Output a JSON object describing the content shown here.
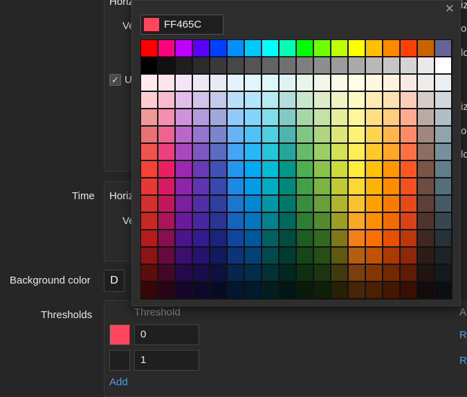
{
  "background_form": {
    "top_label_a": "Horiz",
    "top_label_b": "Ve",
    "check_label": "U",
    "right_labels": [
      "iz",
      "ol",
      "lo",
      "iz",
      "ol",
      "lo"
    ],
    "time_label": "Time",
    "time_horiz": "Horiz",
    "time_ve": "Ve",
    "background_color_label": "Background color",
    "background_color_value": "D",
    "thresholds_label": "Thresholds",
    "threshold_col_header": "Threshold",
    "threshold_col_right": "A",
    "thresholds": [
      {
        "color": "#FF465C",
        "value": "0",
        "action": "R"
      },
      {
        "color": "#1f1f1f",
        "value": "1",
        "action": "R"
      }
    ],
    "add_link": "Add"
  },
  "color_picker": {
    "hex_value": "FF465C",
    "hex_color": "#FF465C",
    "close_icon": "close-icon",
    "palette": [
      [
        "#FF0000",
        "#FF0080",
        "#C000FF",
        "#5A00FF",
        "#0040FF",
        "#0090FF",
        "#00C8FF",
        "#00FFFF",
        "#00FFB4",
        "#00FF00",
        "#70FF00",
        "#C0FF00",
        "#FFFF00",
        "#FFC000",
        "#FF8A00",
        "#FF4000",
        "#C86400",
        "#646496"
      ],
      [
        "#000000",
        "#111111",
        "#1E1E1E",
        "#2B2B2B",
        "#393939",
        "#474747",
        "#555555",
        "#636363",
        "#717171",
        "#7F7F7F",
        "#8E8E8E",
        "#9C9C9C",
        "#AAAAAA",
        "#B8B8B8",
        "#C6C6C6",
        "#D4D4D4",
        "#E9E9E9",
        "#FFFFFF"
      ],
      [
        "#FFEBEE",
        "#FCE4EC",
        "#F3E5F5",
        "#EDE7F6",
        "#E8EAF6",
        "#E3F2FD",
        "#E1F5FE",
        "#E0F7FA",
        "#E0F2F1",
        "#E8F5E9",
        "#F1F8E9",
        "#F9FBE7",
        "#FFFDE7",
        "#FFF8E1",
        "#FFF3E0",
        "#FBE9E7",
        "#EFEBE9",
        "#ECEFF1"
      ],
      [
        "#FFCDD2",
        "#F8BBD0",
        "#E1BEE7",
        "#D1C4E9",
        "#C5CAE9",
        "#BBDEFB",
        "#B3E5FC",
        "#B2EBF2",
        "#B2DFDB",
        "#C8E6C9",
        "#DCEDC8",
        "#F0F4C3",
        "#FFF9C4",
        "#FFECB3",
        "#FFE0B2",
        "#FFCCBC",
        "#D7CCC8",
        "#CFD8DC"
      ],
      [
        "#EF9A9A",
        "#F48FB1",
        "#CE93D8",
        "#B39DDB",
        "#9FA8DA",
        "#90CAF9",
        "#81D4FA",
        "#80DEEA",
        "#80CBC4",
        "#A5D6A7",
        "#C5E1A5",
        "#E6EE9C",
        "#FFF59D",
        "#FFE082",
        "#FFCC80",
        "#FFAB91",
        "#BCAAA4",
        "#B0BEC5"
      ],
      [
        "#E57373",
        "#F06292",
        "#BA68C8",
        "#9575CD",
        "#7986CB",
        "#64B5F6",
        "#4FC3F7",
        "#4DD0E1",
        "#4DB6AC",
        "#81C784",
        "#AED581",
        "#DCE775",
        "#FFF176",
        "#FFD54F",
        "#FFB74D",
        "#FF8A65",
        "#A1887F",
        "#90A4AE"
      ],
      [
        "#EF5350",
        "#EC407A",
        "#AB47BC",
        "#7E57C2",
        "#5C6BC0",
        "#42A5F5",
        "#29B6F6",
        "#26C6DA",
        "#26A69A",
        "#66BB6A",
        "#9CCC65",
        "#D4E157",
        "#FFEE58",
        "#FFCA28",
        "#FFA726",
        "#FF7043",
        "#8D6E63",
        "#78909C"
      ],
      [
        "#F44336",
        "#E91E63",
        "#9C27B0",
        "#673AB7",
        "#3F51B5",
        "#2196F3",
        "#03A9F4",
        "#00BCD4",
        "#009688",
        "#4CAF50",
        "#8BC34A",
        "#CDDC39",
        "#FFEB3B",
        "#FFC107",
        "#FF9800",
        "#FF5722",
        "#795548",
        "#607D8B"
      ],
      [
        "#E53935",
        "#D81B60",
        "#8E24AA",
        "#5E35B1",
        "#3949AB",
        "#1E88E5",
        "#039BE5",
        "#00ACC1",
        "#00897B",
        "#43A047",
        "#7CB342",
        "#C0CA33",
        "#FDD835",
        "#FFB300",
        "#FB8C00",
        "#F4511E",
        "#6D4C41",
        "#546E7A"
      ],
      [
        "#D32F2F",
        "#C2185B",
        "#7B1FA2",
        "#512DA8",
        "#303F9F",
        "#1976D2",
        "#0288D1",
        "#0097A7",
        "#00796B",
        "#388E3C",
        "#689F38",
        "#AFB42B",
        "#FBC02D",
        "#FFA000",
        "#F57C00",
        "#E64A19",
        "#5D4037",
        "#455A64"
      ],
      [
        "#C62828",
        "#AD1457",
        "#6A1B9A",
        "#4527A0",
        "#283593",
        "#1565C0",
        "#0277BD",
        "#00838F",
        "#00695C",
        "#2E7D32",
        "#558B2F",
        "#9E9D24",
        "#F9A825",
        "#FF8F00",
        "#EF6C00",
        "#D84315",
        "#4E342E",
        "#37474F"
      ],
      [
        "#B71C1C",
        "#880E4F",
        "#4A148C",
        "#311B92",
        "#1A237E",
        "#0D47A1",
        "#01579B",
        "#006064",
        "#004D40",
        "#1B5E20",
        "#33691E",
        "#827717",
        "#F57F17",
        "#FF6F00",
        "#E65100",
        "#BF360C",
        "#3E2723",
        "#263238"
      ],
      [
        "#8B1414",
        "#650A3A",
        "#3A0F6E",
        "#241470",
        "#121A5E",
        "#0A3678",
        "#014272",
        "#004A4E",
        "#003A30",
        "#144616",
        "#264E16",
        "#5F5810",
        "#B45E10",
        "#C05200",
        "#A83C00",
        "#8E2808",
        "#2C1C18",
        "#1C2428"
      ],
      [
        "#5E0D0D",
        "#450728",
        "#26094A",
        "#180D4C",
        "#0C113F",
        "#072551",
        "#012D4D",
        "#003235",
        "#002821",
        "#0E300F",
        "#1A350F",
        "#41390B",
        "#7A400B",
        "#823700",
        "#722800",
        "#601B05",
        "#1F1410",
        "#13191C"
      ],
      [
        "#360707",
        "#280417",
        "#16052B",
        "#0E072C",
        "#070A24",
        "#04152F",
        "#001A2D",
        "#001D1F",
        "#001713",
        "#081C09",
        "#0F1F09",
        "#262106",
        "#472506",
        "#4B2000",
        "#421800",
        "#381003",
        "#120B09",
        "#0B0E10"
      ]
    ]
  }
}
